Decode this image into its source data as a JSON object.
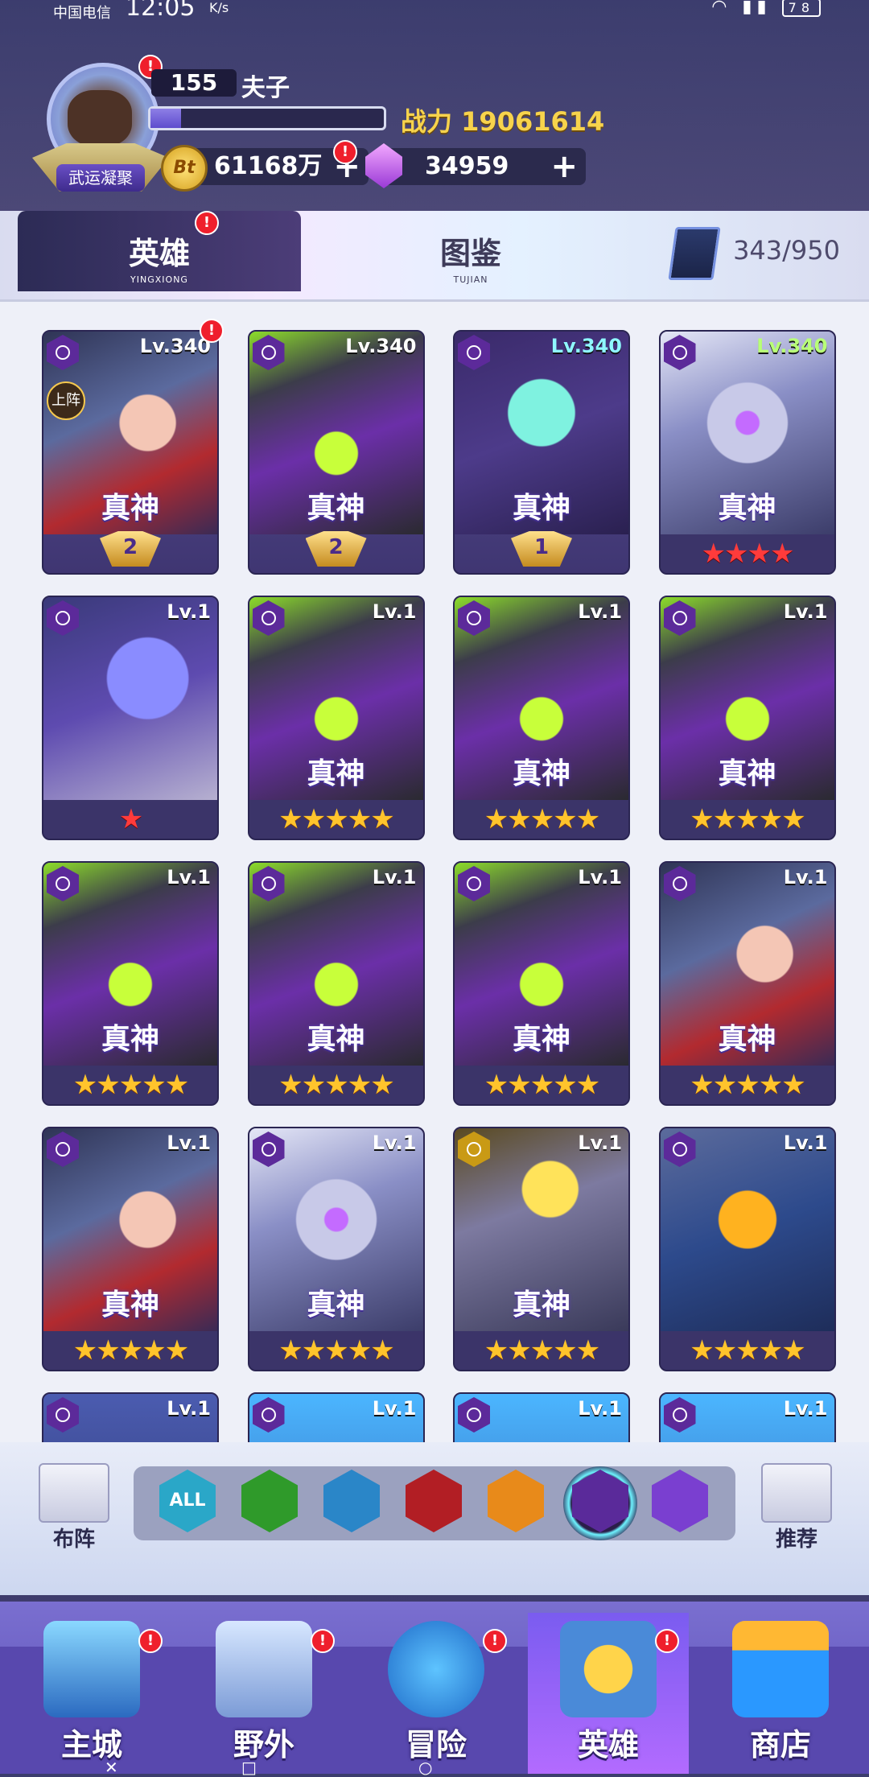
{
  "status_bar": {
    "carrier": "中国电信",
    "time": "12:05",
    "speed": "K/s",
    "battery": "78"
  },
  "player": {
    "level": "155",
    "name": "夫子",
    "xp_fraction": 0.13,
    "power": "战力 19061614",
    "title_badge": "武运凝聚",
    "gold": "61168万",
    "gems": "34959",
    "coin_symbol": "Bt"
  },
  "tabs": [
    {
      "label": "英雄",
      "pinyin": "YINGXIONG",
      "active": true
    },
    {
      "label": "图鉴",
      "pinyin": "TUJIAN",
      "active": false
    }
  ],
  "collection_count": "343/950",
  "cards": [
    {
      "level": "Lv.340",
      "level_color": "white",
      "art": "a-elf",
      "god": "真神",
      "badge": "2",
      "on_team": "上阵",
      "alert": "!"
    },
    {
      "level": "Lv.340",
      "level_color": "white",
      "art": "a-mech",
      "god": "真神",
      "badge": "2"
    },
    {
      "level": "Lv.340",
      "level_color": "cyan",
      "art": "a-zombie",
      "god": "真神",
      "badge": "1"
    },
    {
      "level": "Lv.340",
      "level_color": "green",
      "art": "a-owl",
      "god": "真神",
      "stars": "★★★★",
      "star_color": "red"
    },
    {
      "level": "Lv.1",
      "art": "a-witch",
      "stars": "★",
      "star_color": "red"
    },
    {
      "level": "Lv.1",
      "art": "a-mech",
      "god": "真神",
      "stars": "★★★★★"
    },
    {
      "level": "Lv.1",
      "art": "a-mech",
      "god": "真神",
      "stars": "★★★★★"
    },
    {
      "level": "Lv.1",
      "art": "a-mech",
      "god": "真神",
      "stars": "★★★★★"
    },
    {
      "level": "Lv.1",
      "art": "a-mech",
      "god": "真神",
      "stars": "★★★★★"
    },
    {
      "level": "Lv.1",
      "art": "a-mech",
      "god": "真神",
      "stars": "★★★★★"
    },
    {
      "level": "Lv.1",
      "art": "a-mech",
      "god": "真神",
      "stars": "★★★★★"
    },
    {
      "level": "Lv.1",
      "art": "a-elf",
      "god": "真神",
      "stars": "★★★★★"
    },
    {
      "level": "Lv.1",
      "art": "a-elf",
      "god": "真神",
      "stars": "★★★★★"
    },
    {
      "level": "Lv.1",
      "art": "a-owl",
      "god": "真神",
      "stars": "★★★★★"
    },
    {
      "level": "Lv.1",
      "art": "a-bot",
      "god": "真神",
      "stars": "★★★★★",
      "class_color": "gold"
    },
    {
      "level": "Lv.1",
      "art": "a-globe",
      "stars": "★★★★★"
    },
    {
      "level": "Lv.1",
      "art": "a-gold"
    },
    {
      "level": "Lv.1",
      "art": "a-pink"
    },
    {
      "level": "Lv.1",
      "art": "a-pink"
    },
    {
      "level": "Lv.1",
      "art": "a-pink"
    }
  ],
  "filter": {
    "formation_label": "布阵",
    "recommend_label": "推荐",
    "factions": [
      {
        "icon": "all-faction-icon",
        "label": "ALL",
        "color": "#2aa7c8"
      },
      {
        "icon": "nature-faction-icon",
        "label": "",
        "color": "#2f9a2a"
      },
      {
        "icon": "water-faction-icon",
        "label": "",
        "color": "#2a86c8"
      },
      {
        "icon": "claw-faction-icon",
        "label": "",
        "color": "#b21e24"
      },
      {
        "icon": "sun-faction-icon",
        "label": "",
        "color": "#e88a1a"
      },
      {
        "icon": "eye-faction-icon",
        "label": "",
        "color": "#5a2a9a",
        "selected": true
      },
      {
        "icon": "star-faction-icon",
        "label": "",
        "color": "#7a3fd0"
      }
    ]
  },
  "bottom_nav": [
    {
      "label": "主城",
      "icon": "city-icon",
      "alert": "!"
    },
    {
      "label": "野外",
      "icon": "wild-icon",
      "alert": "!"
    },
    {
      "label": "冒险",
      "icon": "adventure-icon",
      "alert": "!"
    },
    {
      "label": "英雄",
      "icon": "hero-icon",
      "alert": "!",
      "active": true
    },
    {
      "label": "商店",
      "icon": "shop-icon"
    }
  ],
  "colors": {
    "accent": "#f7d34c",
    "alert": "#ef1f2c",
    "star": "#ffc42c"
  }
}
